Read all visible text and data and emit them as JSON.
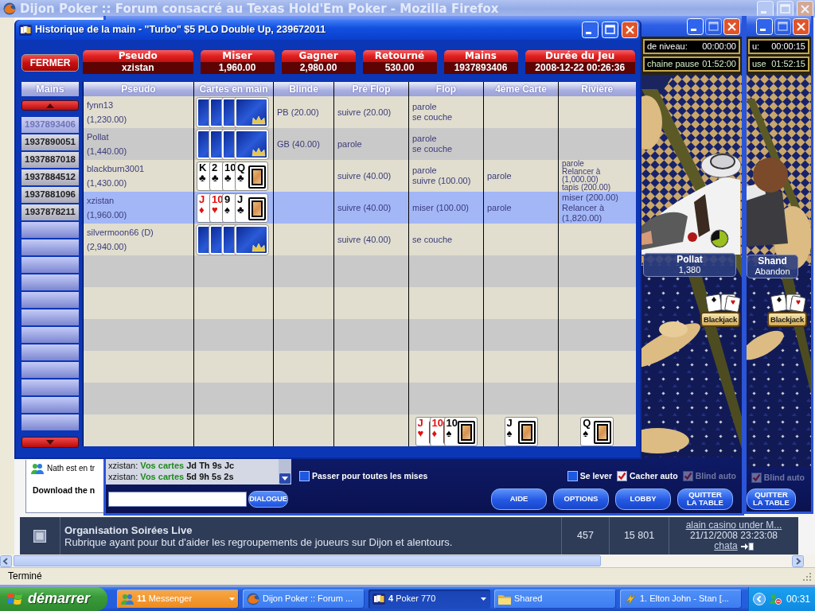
{
  "browser": {
    "title": "Dijon Poker :: Forum consacré au Texas Hold'Em Poker - Mozilla Firefox",
    "forum_row": {
      "title": "Organisation Soirées Live",
      "description": "Rubrique ayant pour but d'aider les regroupements de joueurs sur Dijon et alentours.",
      "topics": "457",
      "posts": "15 801",
      "last_post": {
        "title": "alain casino under M...",
        "date": "21/12/2008 23:23:08",
        "author": "chata"
      }
    },
    "status": "Terminé"
  },
  "messenger_popup": {
    "lines": [
      {
        "kind": "status",
        "text": "Nath est en tr"
      },
      {
        "kind": "link",
        "text": "Download the n"
      }
    ]
  },
  "poker_tables": [
    {
      "timers": [
        {
          "label": "de niveau:",
          "value": "00:00:00"
        },
        {
          "label": "chaine pause",
          "value": "01:52:00"
        }
      ],
      "seat": {
        "name": "Pollat",
        "detail": "1,380",
        "timer": true
      },
      "side_game": "Blackjack",
      "chat": [
        {
          "user": "xzistan:",
          "label": "Vos cartes",
          "text": "Jd Th 9s Jc"
        },
        {
          "user": "xzistan:",
          "label": "Vos cartes",
          "text": "5d 9h 5s 2s"
        }
      ],
      "bet_options": [
        {
          "label": "Passer pour toutes les mises",
          "checked": false,
          "disabled": false
        }
      ],
      "seat_options": [
        {
          "label": "Se lever",
          "checked": false,
          "disabled": false
        },
        {
          "label": "Cacher auto",
          "checked": true,
          "disabled": false
        },
        {
          "label": "Blind auto",
          "checked": true,
          "disabled": true
        }
      ],
      "chat_button": "DIALOGUE",
      "buttons": [
        "AIDE",
        "OPTIONS",
        "LOBBY",
        "QUITTER LA TABLE"
      ]
    },
    {
      "timers": [
        {
          "label": "u:",
          "value": "00:00:15"
        },
        {
          "label": "use",
          "value": "01:52:15"
        }
      ],
      "seat": {
        "name": "Shand",
        "detail": "Abandon",
        "timer": false
      },
      "side_game": "Blackjack",
      "seat_options": [
        {
          "label": "Blind auto",
          "checked": true,
          "disabled": true
        }
      ],
      "buttons": [
        "QUITTER LA TABLE"
      ]
    }
  ],
  "hand_history": {
    "title": "Historique de la main - \"Turbo\" $5 PLO Double Up, 239672011",
    "close_button": "FERMER",
    "summary": [
      {
        "label": "Pseudo",
        "value": "xzistan"
      },
      {
        "label": "Miser",
        "value": "1,960.00"
      },
      {
        "label": "Gagner",
        "value": "2,980.00"
      },
      {
        "label": "Retourné",
        "value": "530.00"
      },
      {
        "label": "Mains",
        "value": "1937893406"
      },
      {
        "label": "Durée du Jeu",
        "value": "2008-12-22 00:26:36"
      }
    ],
    "hands": {
      "title": "Mains",
      "items": [
        {
          "label": "1937893406",
          "selected": true
        },
        {
          "label": "1937890051",
          "selected": false
        },
        {
          "label": "1937887018",
          "selected": false
        },
        {
          "label": "1937884512",
          "selected": false
        },
        {
          "label": "1937881096",
          "selected": false
        },
        {
          "label": "1937878211",
          "selected": false
        }
      ]
    },
    "columns": [
      "Pseudo",
      "Cartes en main",
      "Blinde",
      "Pré Flop",
      "Flop",
      "4éme Carte",
      "Rivière"
    ],
    "rows": [
      {
        "name": "fynn13",
        "stack": "(1,230.00)",
        "selected": false,
        "cards": [
          {
            "kind": "back"
          },
          {
            "kind": "back"
          },
          {
            "kind": "back"
          },
          {
            "kind": "back"
          }
        ],
        "blind": "PB (20.00)",
        "preflop": [
          "suivre (20.00)"
        ],
        "flop": [
          "parole",
          "se couche"
        ]
      },
      {
        "name": "Pollat",
        "stack": "(1,440.00)",
        "selected": false,
        "cards": [
          {
            "kind": "back"
          },
          {
            "kind": "back"
          },
          {
            "kind": "back"
          },
          {
            "kind": "back"
          }
        ],
        "blind": "GB (40.00)",
        "preflop": [
          "parole"
        ],
        "flop": [
          "parole",
          "se couche"
        ]
      },
      {
        "name": "blackburn3001",
        "stack": "(1,430.00)",
        "selected": false,
        "cards": [
          {
            "kind": "face",
            "rank": "K",
            "suit": "♣",
            "color": "#000000"
          },
          {
            "kind": "face",
            "rank": "2",
            "suit": "♣",
            "color": "#000000"
          },
          {
            "kind": "face",
            "rank": "10",
            "suit": "♣",
            "color": "#000000"
          },
          {
            "kind": "face",
            "rank": "Q",
            "suit": "♣",
            "color": "#000000"
          }
        ],
        "preflop": [
          "suivre (40.00)"
        ],
        "flop": [
          "parole",
          "suivre (100.00)"
        ],
        "turn": [
          "parole"
        ],
        "river": [
          "parole",
          "Relancer à",
          "(1,000.00)",
          "tapis (200.00)"
        ]
      },
      {
        "name": "xzistan",
        "stack": "(1,960.00)",
        "selected": true,
        "cards": [
          {
            "kind": "face",
            "rank": "J",
            "suit": "♦",
            "color": "#e01010"
          },
          {
            "kind": "face",
            "rank": "10",
            "suit": "♥",
            "color": "#e01010"
          },
          {
            "kind": "face",
            "rank": "9",
            "suit": "♠",
            "color": "#000000"
          },
          {
            "kind": "face",
            "rank": "J",
            "suit": "♣",
            "color": "#000000"
          }
        ],
        "preflop": [
          "suivre (40.00)"
        ],
        "flop": [
          "miser (100.00)"
        ],
        "turn": [
          "parole"
        ],
        "river": [
          "miser (200.00)",
          "Relancer à",
          "(1,820.00)"
        ]
      },
      {
        "name": "silvermoon66 (D)",
        "stack": "(2,940.00)",
        "selected": false,
        "cards": [
          {
            "kind": "back"
          },
          {
            "kind": "back"
          },
          {
            "kind": "back"
          },
          {
            "kind": "back"
          }
        ],
        "preflop": [
          "suivre (40.00)"
        ],
        "flop": [
          "se couche"
        ]
      }
    ],
    "board": {
      "flop": [
        {
          "kind": "face",
          "rank": "J",
          "suit": "♥",
          "color": "#e01010"
        },
        {
          "kind": "face",
          "rank": "10",
          "suit": "♦",
          "color": "#e01010"
        },
        {
          "kind": "face",
          "rank": "10",
          "suit": "♠",
          "color": "#000000"
        }
      ],
      "turn": [
        {
          "kind": "face",
          "rank": "J",
          "suit": "♠",
          "color": "#000000"
        }
      ],
      "river": [
        {
          "kind": "face",
          "rank": "Q",
          "suit": "♠",
          "color": "#000000"
        }
      ]
    }
  },
  "taskbar": {
    "start": "démarrer",
    "tasks": [
      {
        "kind": "messenger",
        "count": "11",
        "label": "Messenger",
        "attention": true,
        "selected": false
      },
      {
        "kind": "browser",
        "label": "Dijon Poker :: Forum ...",
        "attention": false,
        "selected": false
      },
      {
        "kind": "poker",
        "count": "4",
        "label": "Poker 770",
        "attention": false,
        "selected": true
      },
      {
        "kind": "folder",
        "label": "Shared",
        "attention": false,
        "selected": false
      },
      {
        "kind": "media",
        "label": "1. Elton John - Stan [...",
        "attention": false,
        "selected": false
      }
    ],
    "clock": "00:31"
  }
}
